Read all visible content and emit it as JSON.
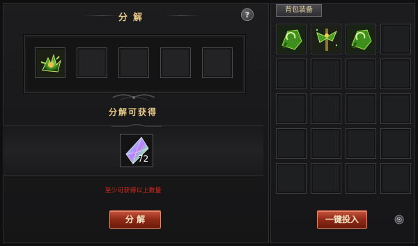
{
  "left_panel": {
    "title": "分解",
    "help_label": "?",
    "result_label": "分解可获得",
    "reward": {
      "count": "72",
      "icon": "rainbow-crystal-icon"
    },
    "notice": "至少可获得以上数量",
    "decompose_button": "分 解",
    "input_slots": [
      {
        "item": "green-claw-equipment-icon"
      },
      {
        "item": ""
      },
      {
        "item": ""
      },
      {
        "item": ""
      },
      {
        "item": ""
      }
    ]
  },
  "right_panel": {
    "tab_label": "背包装备",
    "put_all_button": "一键投入",
    "settings_icon": "gear-icon",
    "grid": {
      "rows": 5,
      "cols": 4,
      "items": [
        "green-jade-bracer-icon",
        "green-thorn-staff-icon",
        "green-jade-bracer-icon"
      ]
    }
  },
  "colors": {
    "title_gold": "#e8c98a",
    "notice_red": "#e0281b",
    "button_red": "#8f2a17"
  }
}
